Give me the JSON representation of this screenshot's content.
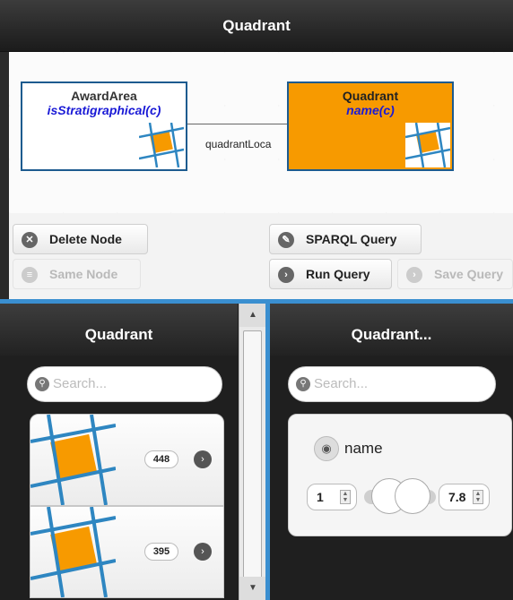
{
  "app": {
    "title": "Quadrant"
  },
  "graph": {
    "nodes": [
      {
        "title": "AwardArea",
        "predicate": "isStratigraphical(c)"
      },
      {
        "title": "Quadrant",
        "predicate": "name(c)"
      }
    ],
    "edge_label": "quadrantLoca"
  },
  "toolbar": {
    "delete_node": "Delete Node",
    "same_node": "Same Node",
    "sparql_query": "SPARQL Query",
    "run_query": "Run Query",
    "save_query": "Save Query"
  },
  "left_panel": {
    "title": "Quadrant",
    "search_placeholder": "Search...",
    "items": [
      {
        "count": "448"
      },
      {
        "count": "395"
      }
    ]
  },
  "right_panel": {
    "title": "Quadrant...",
    "search_placeholder": "Search...",
    "facet": {
      "name": "name",
      "min": "1",
      "max": "7.8"
    }
  },
  "colors": {
    "accent_blue": "#3a8fd0",
    "node_orange": "#f79a00",
    "node_border": "#1d5b8f"
  }
}
